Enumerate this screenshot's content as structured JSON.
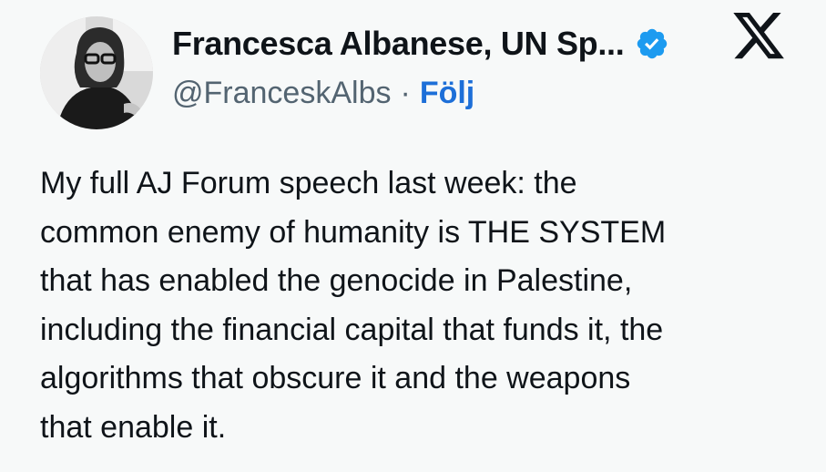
{
  "author": {
    "display_name": "Francesca Albanese, UN Sp...",
    "handle": "@FranceskAlbs",
    "separator": "·",
    "follow_label": "Följ",
    "verified": true
  },
  "icons": {
    "verified": "verified-badge-icon",
    "platform": "x-logo-icon"
  },
  "tweet": {
    "lines": [
      "My full AJ Forum speech last week: the",
      "common enemy of humanity is THE SYSTEM",
      "that has enabled the genocide in Palestine,",
      "including the financial capital that funds it, the",
      "algorithms that obscure it and the weapons",
      "that enable it."
    ]
  },
  "colors": {
    "background": "#f7f9f9",
    "text": "#0f1419",
    "secondary_text": "#536471",
    "accent": "#1d6fd8",
    "verified_badge": "#1d9bf0"
  }
}
